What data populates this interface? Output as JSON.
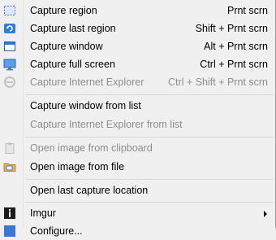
{
  "menu": {
    "items": [
      {
        "label": "Capture region",
        "shortcut": "Prnt scrn",
        "icon": "region-select-icon",
        "enabled": true
      },
      {
        "label": "Capture last region",
        "shortcut": "Shift + Prnt scrn",
        "icon": "last-region-icon",
        "enabled": true
      },
      {
        "label": "Capture window",
        "shortcut": "Alt + Prnt scrn",
        "icon": "window-icon",
        "enabled": true
      },
      {
        "label": "Capture full screen",
        "shortcut": "Ctrl + Prnt scrn",
        "icon": "monitor-icon",
        "enabled": true
      },
      {
        "label": "Capture Internet Explorer",
        "shortcut": "Ctrl + Shift + Prnt scrn",
        "icon": "internet-explorer-icon",
        "enabled": false
      },
      {
        "label": "Capture window from list",
        "enabled": true
      },
      {
        "label": "Capture Internet Explorer from list",
        "enabled": false
      },
      {
        "label": "Open image from clipboard",
        "icon": "clipboard-icon",
        "enabled": false
      },
      {
        "label": "Open image from file",
        "icon": "folder-icon",
        "enabled": true
      },
      {
        "label": "Open last capture location",
        "enabled": true
      },
      {
        "label": "Imgur",
        "icon": "imgur-icon",
        "enabled": true,
        "submenu": true
      },
      {
        "label": "Configure...",
        "icon": "settings-icon",
        "enabled": true
      }
    ]
  }
}
